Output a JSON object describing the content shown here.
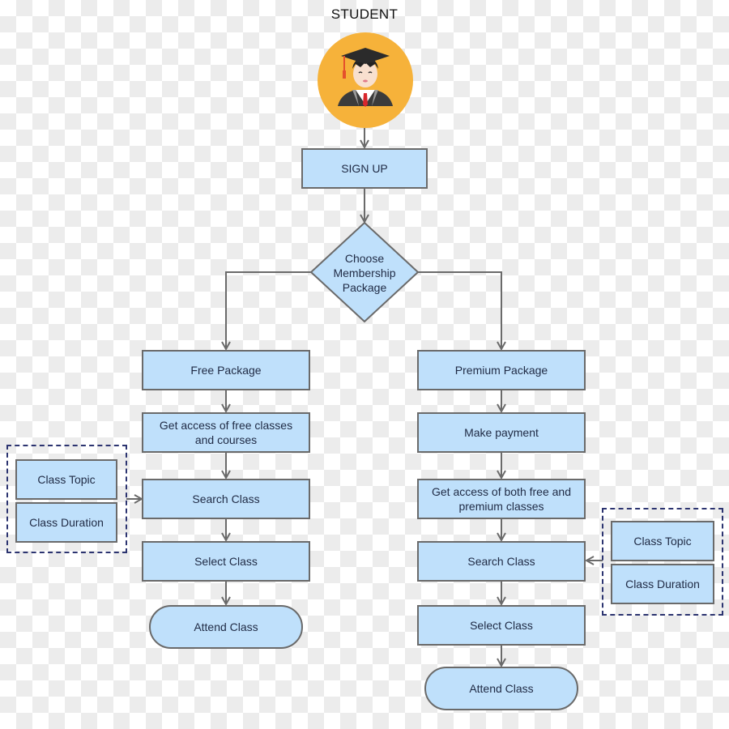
{
  "diagram": {
    "actor_label": "STUDENT",
    "actor_icon": "graduate-student-icon",
    "signup": "SIGN UP",
    "decision": "Choose Membership Package",
    "colors": {
      "node_fill": "#bfe0fb",
      "node_border": "#6a6a6a",
      "avatar_bg": "#f6b23a",
      "dashed_border": "#2c3470"
    },
    "free_branch": {
      "package": "Free Package",
      "access": "Get access of free classes and courses",
      "search": "Search Class",
      "select": "Select Class",
      "attend": "Attend Class",
      "filters": [
        "Class Topic",
        "Class Duration"
      ]
    },
    "premium_branch": {
      "package": "Premium Package",
      "payment": "Make payment",
      "access": "Get access of both free and premium classes",
      "search": "Search Class",
      "select": "Select Class",
      "attend": "Attend Class",
      "filters": [
        "Class Topic",
        "Class Duration"
      ]
    }
  }
}
